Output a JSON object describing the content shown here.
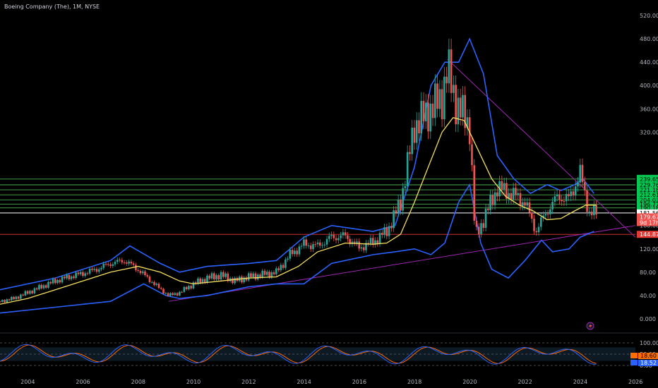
{
  "header": {
    "title": "Boeing Company (The), 1M, NYSE"
  },
  "colors": {
    "background": "#000000",
    "up_candle": "#26a69a",
    "down_candle": "#ef5350",
    "bollinger_band": "#2962ff",
    "moving_average": "#f5e060",
    "trendline": "#9c27b0",
    "support_resistance": "#4caf50",
    "support_red": "#e53935",
    "stoch_k": "#2962ff",
    "stoch_d": "#ff6d00"
  },
  "price_labels": [
    "520.00",
    "480.00",
    "440.00",
    "400.00",
    "360.00",
    "320.00",
    "160.00",
    "120.00",
    "80.00",
    "40.00",
    "0.000"
  ],
  "price_label_values": [
    520,
    480,
    440,
    400,
    360,
    320,
    160,
    120,
    80,
    40,
    0
  ],
  "green_levels": [
    "239.65",
    "229.76",
    "221.18",
    "212.61",
    "204.03",
    "196.77",
    "190.18"
  ],
  "green_level_values": [
    239.65,
    229.76,
    221.18,
    212.61,
    204.03,
    196.77,
    190.18
  ],
  "tag_current": "181.56",
  "tag_close": "179.67",
  "tag_countdown": "9d 17h",
  "tag_support": "144.87",
  "x_labels": [
    "2004",
    "2006",
    "2008",
    "2010",
    "2012",
    "2014",
    "2016",
    "2018",
    "2020",
    "2022",
    "2024",
    "2026"
  ],
  "stoch": {
    "labels": [
      "100.00",
      "50.00",
      "0.00"
    ],
    "k_value": "18.60",
    "d_value": "18.52"
  },
  "icons": {
    "alert": "lightning-alert-icon"
  },
  "chart_data": {
    "type": "candlestick",
    "title": "Boeing Company (The), 1M, NYSE",
    "interval": "1M",
    "exchange": "NYSE",
    "x_range": [
      2003.0,
      2026.0
    ],
    "y_range": [
      0,
      540
    ],
    "series": [
      {
        "name": "close",
        "x": [
          2003.0,
          2003.5,
          2004.0,
          2004.5,
          2005.0,
          2005.5,
          2006.0,
          2006.5,
          2007.0,
          2007.5,
          2007.9,
          2008.3,
          2008.7,
          2009.1,
          2009.5,
          2010.0,
          2010.5,
          2011.0,
          2011.5,
          2012.0,
          2012.5,
          2013.0,
          2013.5,
          2014.0,
          2014.5,
          2015.0,
          2015.5,
          2016.0,
          2016.5,
          2017.0,
          2017.5,
          2018.0,
          2018.5,
          2019.0,
          2019.2,
          2019.5,
          2020.0,
          2020.2,
          2020.5,
          2021.0,
          2021.5,
          2022.0,
          2022.4,
          2022.8,
          2023.2,
          2023.6,
          2024.0,
          2024.3,
          2024.6
        ],
        "values": [
          30,
          35,
          45,
          55,
          65,
          72,
          78,
          85,
          95,
          100,
          88,
          72,
          55,
          40,
          45,
          60,
          70,
          75,
          65,
          72,
          76,
          80,
          110,
          128,
          125,
          140,
          142,
          122,
          132,
          150,
          200,
          330,
          355,
          380,
          430,
          370,
          330,
          140,
          170,
          225,
          215,
          200,
          150,
          185,
          210,
          205,
          250,
          185,
          179.67
        ]
      },
      {
        "name": "moving average",
        "x": [
          2003.0,
          2004.0,
          2005.0,
          2006.0,
          2007.0,
          2008.0,
          2008.8,
          2009.5,
          2010.0,
          2011.0,
          2012.0,
          2013.0,
          2013.8,
          2014.5,
          2015.5,
          2016.5,
          2017.0,
          2017.5,
          2018.0,
          2018.5,
          2019.0,
          2019.4,
          2019.8,
          2020.3,
          2020.8,
          2021.3,
          2021.8,
          2022.3,
          2022.8,
          2023.3,
          2023.8,
          2024.2,
          2024.6
        ],
        "values": [
          25,
          35,
          50,
          65,
          80,
          90,
          80,
          65,
          60,
          65,
          70,
          72,
          90,
          115,
          130,
          128,
          130,
          145,
          200,
          260,
          320,
          345,
          340,
          290,
          240,
          210,
          195,
          185,
          170,
          172,
          185,
          195,
          195
        ]
      },
      {
        "name": "bollinger upper",
        "x": [
          2003.0,
          2005.0,
          2007.0,
          2007.7,
          2008.8,
          2009.5,
          2010.5,
          2012.0,
          2013.0,
          2014.0,
          2015.0,
          2016.5,
          2017.3,
          2018.0,
          2018.6,
          2019.1,
          2019.6,
          2020.0,
          2020.5,
          2021.0,
          2021.6,
          2022.2,
          2022.8,
          2023.3,
          2023.8,
          2024.1,
          2024.5
        ],
        "values": [
          50,
          70,
          100,
          125,
          95,
          80,
          90,
          95,
          100,
          140,
          160,
          150,
          160,
          260,
          400,
          440,
          440,
          480,
          420,
          280,
          240,
          215,
          230,
          220,
          230,
          240,
          215
        ]
      },
      {
        "name": "bollinger lower",
        "x": [
          2003.0,
          2005.0,
          2007.0,
          2008.2,
          2009.0,
          2009.5,
          2010.5,
          2012.0,
          2013.0,
          2014.0,
          2015.0,
          2016.5,
          2017.3,
          2018.0,
          2018.6,
          2019.1,
          2019.6,
          2020.0,
          2020.4,
          2020.8,
          2021.4,
          2022.0,
          2022.6,
          2023.0,
          2023.6,
          2024.0,
          2024.5
        ],
        "values": [
          10,
          20,
          30,
          60,
          40,
          35,
          40,
          55,
          60,
          60,
          95,
          110,
          115,
          120,
          110,
          130,
          200,
          230,
          130,
          85,
          70,
          100,
          135,
          115,
          120,
          140,
          150
        ]
      }
    ],
    "trendlines": [
      {
        "name": "long-term support",
        "from": [
          2009.1,
          30
        ],
        "to": [
          2026.0,
          160
        ]
      },
      {
        "name": "descending resistance",
        "from": [
          2019.2,
          445
        ],
        "to": [
          2026.0,
          140
        ]
      }
    ],
    "horizontal_levels": [
      239.65,
      229.76,
      221.18,
      212.61,
      204.03,
      196.77,
      190.18,
      181.56,
      144.87
    ]
  }
}
